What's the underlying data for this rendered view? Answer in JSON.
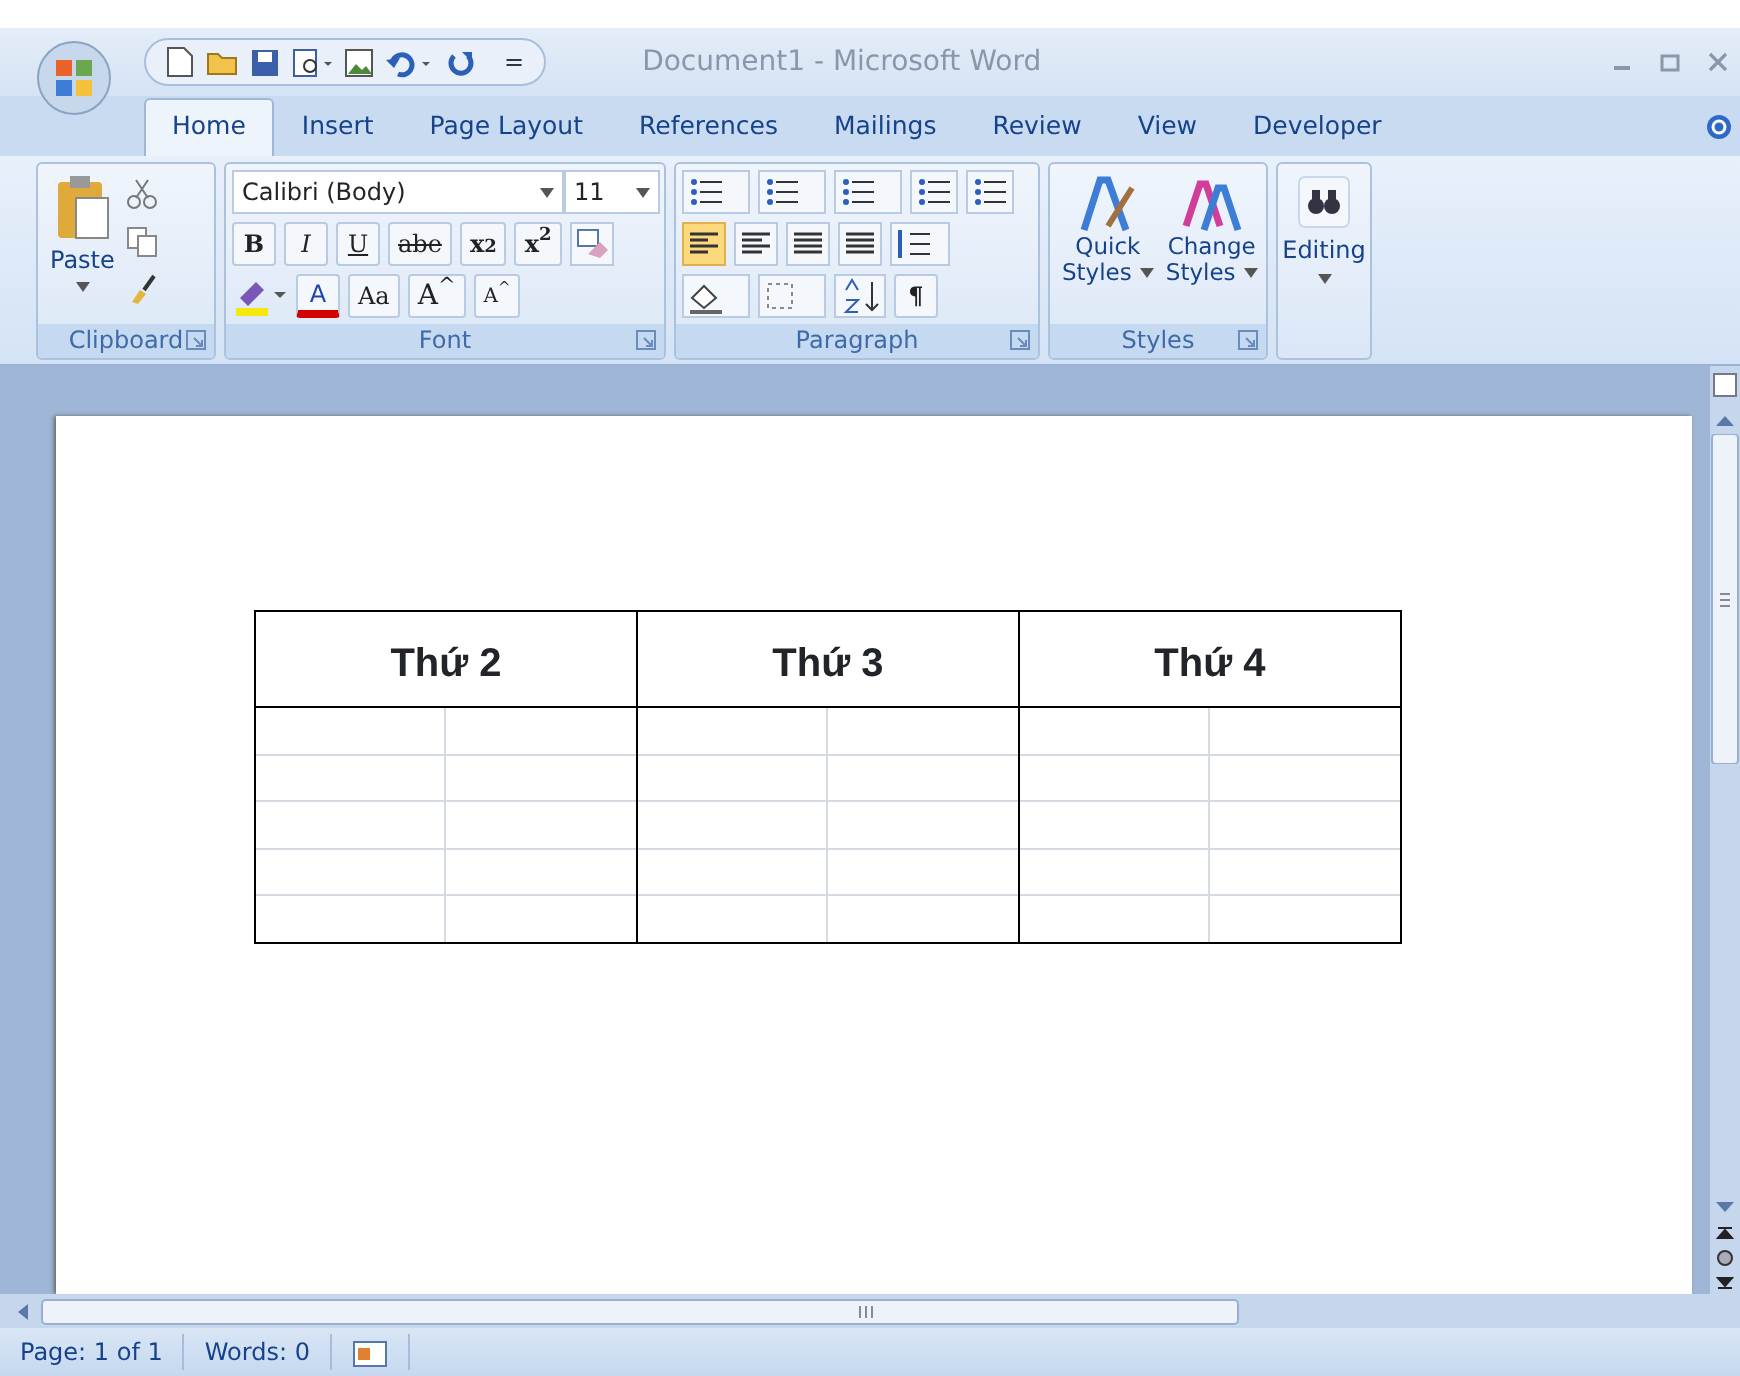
{
  "window": {
    "title": "Document1 - Microsoft Word"
  },
  "quick_access": {
    "more": "="
  },
  "tabs": [
    {
      "label": "Home",
      "selected": true
    },
    {
      "label": "Insert",
      "selected": false
    },
    {
      "label": "Page Layout",
      "selected": false
    },
    {
      "label": "References",
      "selected": false
    },
    {
      "label": "Mailings",
      "selected": false
    },
    {
      "label": "Review",
      "selected": false
    },
    {
      "label": "View",
      "selected": false
    },
    {
      "label": "Developer",
      "selected": false
    }
  ],
  "ribbon": {
    "clipboard": {
      "label": "Clipboard",
      "paste": "Paste"
    },
    "font": {
      "label": "Font",
      "font_name": "Calibri (Body)",
      "font_size": "11",
      "format_buttons": [
        {
          "label": "B",
          "kind": "bold"
        },
        {
          "label": "I",
          "kind": "italic"
        },
        {
          "label": "U",
          "kind": "underline"
        },
        {
          "label": "abe",
          "kind": "strike"
        },
        {
          "label": "x$_{2}$",
          "kind": "plain"
        },
        {
          "label": "x$^{2}$",
          "kind": "plain"
        }
      ],
      "color_buttons": [
        {
          "label": "A",
          "kind": "fontcolor"
        },
        {
          "label": "Aa",
          "kind": "case"
        },
        {
          "label": "A$^{^}$",
          "kind": "grow"
        },
        {
          "label": "A$^{^}$",
          "kind": "shrink"
        }
      ]
    },
    "paragraph": {
      "label": "Paragraph",
      "alignments": [
        {
          "selected": true
        },
        {
          "selected": false
        },
        {
          "selected": false
        },
        {
          "selected": false
        }
      ],
      "pilcrow": "¶"
    },
    "styles": {
      "label": "Styles",
      "buttons": [
        {
          "line1": "Quick",
          "line2": "Styles"
        },
        {
          "line1": "Change",
          "line2": "Styles"
        }
      ]
    },
    "editing": {
      "label": "Editing"
    }
  },
  "document": {
    "table": {
      "headers": [
        "Thứ 2",
        "Thứ 3",
        "Thứ 4"
      ]
    }
  },
  "status_bar": [
    "Page: 1 of 1",
    "Words: 0"
  ]
}
